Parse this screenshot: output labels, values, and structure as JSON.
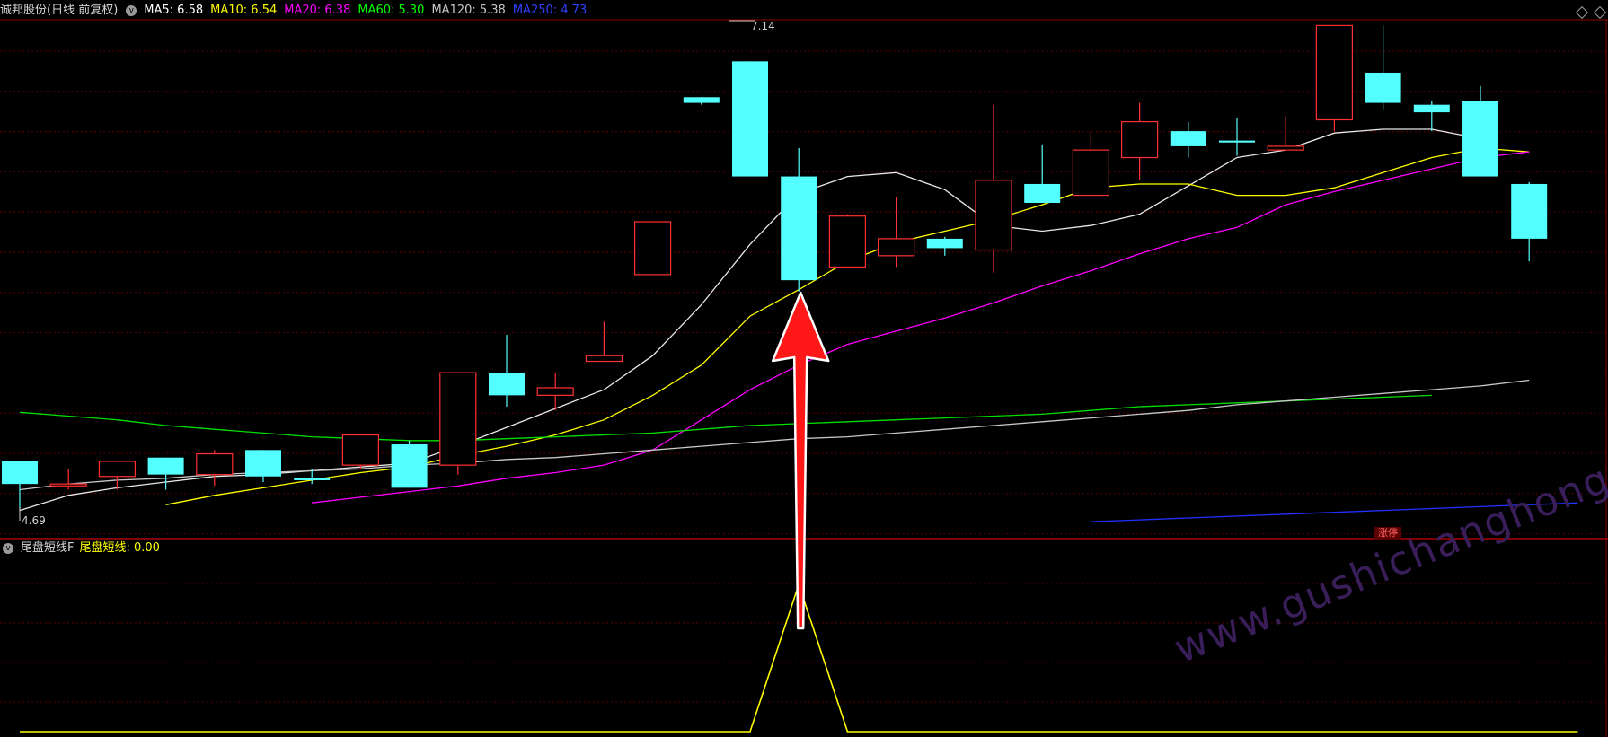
{
  "main_legend": {
    "title": "诚邦股份(日线 前复权)",
    "items": [
      {
        "label": "MA5: 6.58",
        "color": "#ffffff"
      },
      {
        "label": "MA10: 6.54",
        "color": "#ffff00"
      },
      {
        "label": "MA20: 6.38",
        "color": "#ff00ff"
      },
      {
        "label": "MA60: 5.30",
        "color": "#00ff00"
      },
      {
        "label": "MA120: 5.38",
        "color": "#c8c8c8"
      },
      {
        "label": "MA250: 4.73",
        "color": "#3040ff"
      }
    ]
  },
  "sub_legend": {
    "title": "尾盘短线F",
    "value_label": "尾盘短线: 0.00",
    "value_color": "#ffff00"
  },
  "price_marks": {
    "high": "7.14",
    "low": "4.69"
  },
  "tag_label": "涨停",
  "watermark": "www.gushichanghong.com",
  "chart_data": {
    "type": "candlestick",
    "y_range": [
      4.55,
      7.3
    ],
    "candles": [
      {
        "o": 4.95,
        "c": 4.83,
        "h": 4.95,
        "l": 4.69
      },
      {
        "o": 4.82,
        "c": 4.83,
        "h": 4.91,
        "l": 4.8
      },
      {
        "o": 4.87,
        "c": 4.95,
        "h": 4.95,
        "l": 4.8
      },
      {
        "o": 4.97,
        "c": 4.88,
        "h": 4.97,
        "l": 4.8
      },
      {
        "o": 4.88,
        "c": 4.99,
        "h": 5.01,
        "l": 4.82
      },
      {
        "o": 5.01,
        "c": 4.87,
        "h": 5.01,
        "l": 4.84
      },
      {
        "o": 4.86,
        "c": 4.85,
        "h": 4.91,
        "l": 4.83
      },
      {
        "o": 4.93,
        "c": 5.09,
        "h": 5.09,
        "l": 4.91
      },
      {
        "o": 5.04,
        "c": 4.81,
        "h": 5.06,
        "l": 4.81
      },
      {
        "o": 4.93,
        "c": 5.42,
        "h": 5.42,
        "l": 4.88
      },
      {
        "o": 5.42,
        "c": 5.3,
        "h": 5.62,
        "l": 5.24
      },
      {
        "o": 5.3,
        "c": 5.34,
        "h": 5.42,
        "l": 5.22
      },
      {
        "o": 5.48,
        "c": 5.51,
        "h": 5.69,
        "l": 5.48
      },
      {
        "o": 5.94,
        "c": 6.22,
        "h": 6.22,
        "l": 5.94
      },
      {
        "o": 6.88,
        "c": 6.85,
        "h": 6.88,
        "l": 6.84
      },
      {
        "o": 7.07,
        "c": 6.46,
        "h": 7.07,
        "l": 6.46
      },
      {
        "o": 6.46,
        "c": 5.91,
        "h": 6.61,
        "l": 5.85
      },
      {
        "o": 5.98,
        "c": 6.25,
        "h": 6.26,
        "l": 5.98
      },
      {
        "o": 6.04,
        "c": 6.13,
        "h": 6.35,
        "l": 5.98
      },
      {
        "o": 6.13,
        "c": 6.08,
        "h": 6.14,
        "l": 6.04
      },
      {
        "o": 6.07,
        "c": 6.44,
        "h": 6.84,
        "l": 5.95
      },
      {
        "o": 6.42,
        "c": 6.32,
        "h": 6.63,
        "l": 6.32
      },
      {
        "o": 6.36,
        "c": 6.6,
        "h": 6.7,
        "l": 6.36
      },
      {
        "o": 6.56,
        "c": 6.75,
        "h": 6.85,
        "l": 6.44
      },
      {
        "o": 6.7,
        "c": 6.62,
        "h": 6.75,
        "l": 6.56
      },
      {
        "o": 6.65,
        "c": 6.64,
        "h": 6.77,
        "l": 6.57
      },
      {
        "o": 6.6,
        "c": 6.62,
        "h": 6.78,
        "l": 6.6
      },
      {
        "o": 6.76,
        "c": 7.26,
        "h": 7.26,
        "l": 6.7
      },
      {
        "o": 7.01,
        "c": 6.85,
        "h": 7.26,
        "l": 6.81
      },
      {
        "o": 6.84,
        "c": 6.8,
        "h": 6.86,
        "l": 6.7
      },
      {
        "o": 6.86,
        "c": 6.46,
        "h": 6.94,
        "l": 6.46
      },
      {
        "o": 6.42,
        "c": 6.13,
        "h": 6.43,
        "l": 6.01
      }
    ],
    "ma": [
      {
        "name": "MA5",
        "color": "#e8e8e8",
        "start": 0,
        "values": [
          4.69,
          4.77,
          4.81,
          4.84,
          4.87,
          4.88,
          4.9,
          4.92,
          4.94,
          5.03,
          5.13,
          5.23,
          5.33,
          5.51,
          5.78,
          6.1,
          6.37,
          6.46,
          6.48,
          6.39,
          6.2,
          6.17,
          6.2,
          6.26,
          6.41,
          6.56,
          6.6,
          6.69,
          6.71,
          6.71,
          6.66
        ]
      },
      {
        "name": "MA10",
        "color": "#ffff00",
        "start": 3,
        "values": [
          4.72,
          4.77,
          4.81,
          4.85,
          4.89,
          4.92,
          4.98,
          5.03,
          5.09,
          5.17,
          5.3,
          5.46,
          5.72,
          5.86,
          6.01,
          6.11,
          6.17,
          6.23,
          6.31,
          6.4,
          6.42,
          6.42,
          6.36,
          6.36,
          6.4,
          6.48,
          6.56,
          6.61,
          6.59
        ]
      },
      {
        "name": "MA20",
        "color": "#ff00ff",
        "start": 6,
        "values": [
          4.73,
          4.76,
          4.79,
          4.82,
          4.86,
          4.89,
          4.93,
          5.01,
          5.17,
          5.33,
          5.46,
          5.57,
          5.64,
          5.71,
          5.79,
          5.88,
          5.96,
          6.05,
          6.13,
          6.19,
          6.31,
          6.38,
          6.44,
          6.5,
          6.56,
          6.59
        ]
      },
      {
        "name": "MA60",
        "color": "#00e000",
        "start": 0,
        "end": 32,
        "values": [
          5.21,
          5.19,
          5.17,
          5.14,
          5.12,
          5.1,
          5.08,
          5.07,
          5.06,
          5.06,
          5.07,
          5.08,
          5.09,
          5.1,
          5.12,
          5.14,
          5.15,
          5.16,
          5.17,
          5.18,
          5.19,
          5.2,
          5.22,
          5.24,
          5.25,
          5.26,
          5.27,
          5.28,
          5.29,
          5.3
        ]
      },
      {
        "name": "MA120",
        "color": "#c8c8c8",
        "start": 0,
        "end": 32,
        "values": [
          4.8,
          4.83,
          4.85,
          4.86,
          4.88,
          4.89,
          4.9,
          4.91,
          4.93,
          4.94,
          4.96,
          4.97,
          4.99,
          5.01,
          5.03,
          5.05,
          5.07,
          5.08,
          5.1,
          5.12,
          5.14,
          5.16,
          5.18,
          5.2,
          5.22,
          5.25,
          5.27,
          5.29,
          5.31,
          5.33,
          5.35,
          5.38
        ]
      },
      {
        "name": "MA250",
        "color": "#2030ff",
        "start": 22,
        "end": 32,
        "values": [
          4.63,
          4.64,
          4.65,
          4.66,
          4.67,
          4.68,
          4.69,
          4.7,
          4.71,
          4.72,
          4.73
        ]
      }
    ],
    "indicator": {
      "name": "尾盘短线",
      "color": "#ffff00",
      "y_range": [
        0,
        1
      ],
      "values": [
        0,
        0,
        0,
        0,
        0,
        0,
        0,
        0,
        0,
        0,
        0,
        0,
        0,
        0,
        0,
        0,
        0.85,
        0,
        0,
        0,
        0,
        0,
        0,
        0,
        0,
        0,
        0,
        0,
        0,
        0,
        0,
        0,
        0
      ],
      "x_offset": 0
    }
  }
}
